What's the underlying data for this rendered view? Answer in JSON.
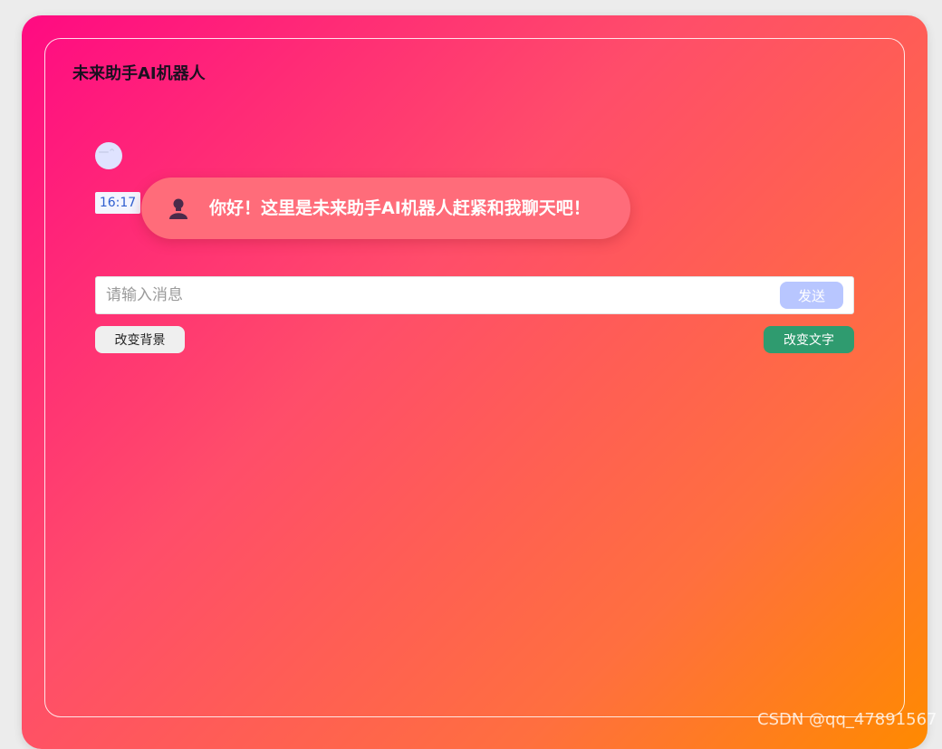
{
  "app": {
    "title": "未来助手AI机器人"
  },
  "chat": {
    "bot_avatar_icon": "bot-avatar-icon",
    "time": "16:17",
    "greeting": "你好！这里是未来助手AI机器人赶紧和我聊天吧！",
    "bubble_icon": "user-silhouette-icon"
  },
  "composer": {
    "placeholder": "请输入消息",
    "value": "",
    "send_label": "发送"
  },
  "actions": {
    "change_background_label": "改变背景",
    "change_text_label": "改变文字"
  },
  "watermark": "CSDN @qq_47891567",
  "colors": {
    "gradient_start": "#ff0a82",
    "gradient_end": "#ff8a00",
    "bubble": "#ff6c7a",
    "send_button": "#b8c6ff",
    "change_text_button": "#2f9b6f"
  }
}
